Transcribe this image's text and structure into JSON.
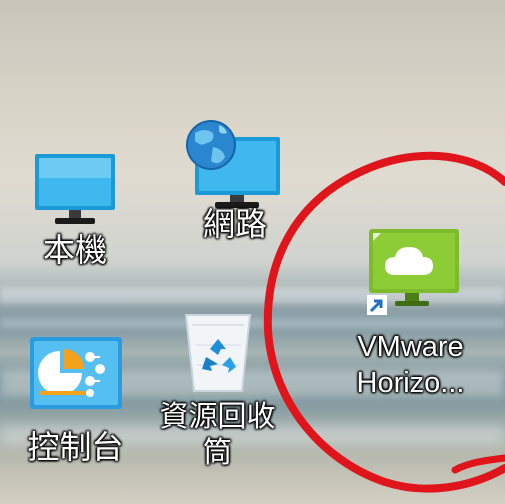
{
  "desktop": {
    "icons": [
      {
        "label": "本機",
        "icon": "computer-icon"
      },
      {
        "label": "網路",
        "icon": "network-icon"
      },
      {
        "label": "控制台",
        "icon": "control-panel-icon"
      },
      {
        "label": "資源回收筒",
        "label_line1": "資源回收",
        "label_line2": "筒",
        "icon": "recycle-bin-icon"
      },
      {
        "label": "VMware Horizo...",
        "label_line1": "VMware",
        "label_line2": "Horizo...",
        "icon": "vmware-horizon-icon",
        "shortcut": true
      }
    ],
    "annotation_color": "#e0141b"
  }
}
